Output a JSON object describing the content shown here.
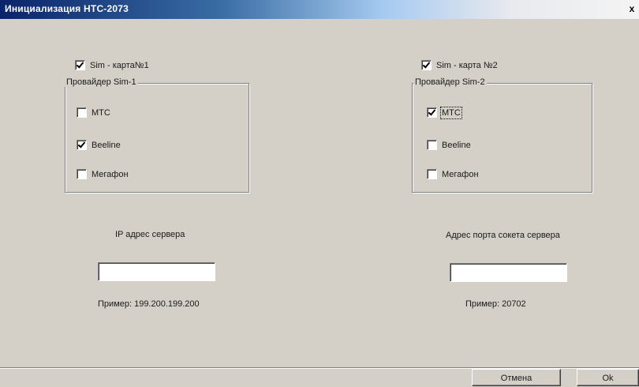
{
  "window": {
    "title": "Инициализация НТС-2073",
    "close_glyph": "x"
  },
  "sim1": {
    "enable_label": "Sim - карта№1",
    "enabled": true,
    "group_label": "Провайдер Sim-1",
    "providers": [
      {
        "label": "МТС",
        "checked": false
      },
      {
        "label": "Beeline",
        "checked": true
      },
      {
        "label": "Мегафон",
        "checked": false
      }
    ]
  },
  "sim2": {
    "enable_label": "Sim - карта №2",
    "enabled": true,
    "group_label": "Провайдер Sim-2",
    "providers": [
      {
        "label": "МТС",
        "checked": true
      },
      {
        "label": "Beeline",
        "checked": false
      },
      {
        "label": "Мегафон",
        "checked": false
      }
    ]
  },
  "server": {
    "ip_label": "IP адрес сервера",
    "ip_value": "",
    "ip_example": "Пример: 199.200.199.200",
    "port_label": "Адрес порта сокета сервера",
    "port_value": "",
    "port_example": "Пример: 20702"
  },
  "buttons": {
    "cancel_label": "Отмена",
    "ok_label": "Ok"
  }
}
